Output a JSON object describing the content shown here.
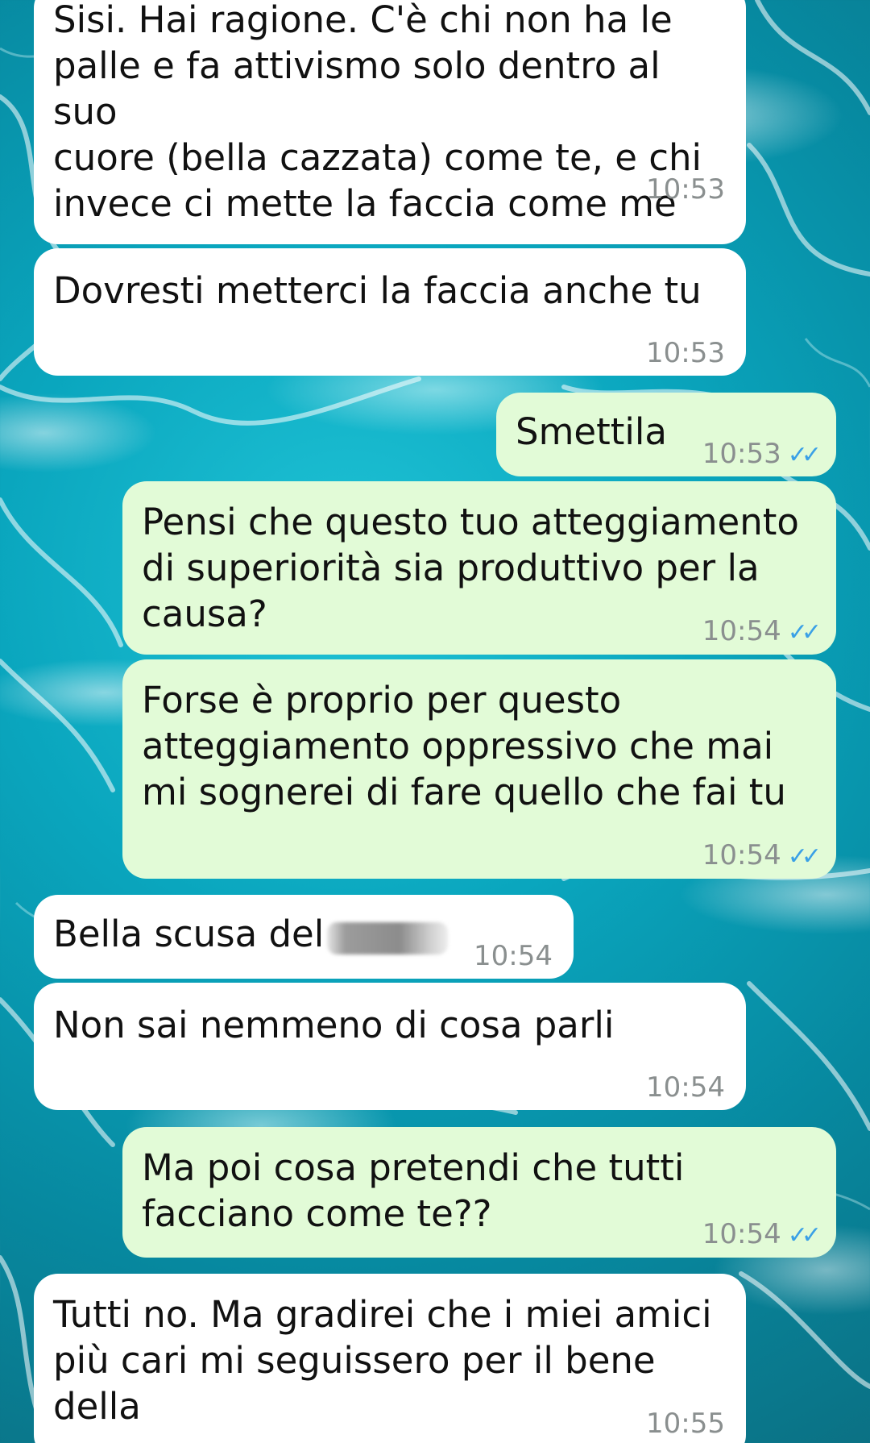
{
  "chat": {
    "messages": [
      {
        "direction": "incoming",
        "text": "Sisi. Hai ragione. C'è chi non ha le\npalle e fa attivismo solo dentro al suo\ncuore (bella cazzata) come te, e chi\ninvece ci mette la faccia come me",
        "time": "10:53"
      },
      {
        "direction": "incoming",
        "text": "Dovresti metterci la faccia anche tu",
        "time": "10:53"
      },
      {
        "direction": "outgoing",
        "text": "Smettila",
        "time": "10:53",
        "status": "read-double-check-icon"
      },
      {
        "direction": "outgoing",
        "text": "Pensi che questo tuo atteggiamento\ndi superiorità sia produttivo per la\ncausa?",
        "time": "10:54",
        "status": "read-double-check-icon"
      },
      {
        "direction": "outgoing",
        "text": "Forse è proprio per questo\natteggiamento oppressivo che mai\nmi sognerei di fare quello che fai tu",
        "time": "10:54",
        "status": "read-double-check-icon"
      },
      {
        "direction": "incoming",
        "text": "Bella scusa del",
        "time": "10:54",
        "redacted": true
      },
      {
        "direction": "incoming",
        "text": "Non sai nemmeno di cosa parli",
        "time": "10:54"
      },
      {
        "direction": "outgoing",
        "text": "Ma poi cosa pretendi che tutti\nfacciano come te??",
        "time": "10:54",
        "status": "read-double-check-icon"
      },
      {
        "direction": "incoming",
        "text": "Tutti no. Ma gradirei che i miei amici\npiù cari mi seguissero per il bene della\ncausa",
        "time": "10:55"
      }
    ]
  },
  "colors": {
    "incoming_bubble": "#ffffff",
    "outgoing_bubble": "#e2fbd7",
    "read_ticks": "#3aa0e6",
    "timestamp": "#8a8f8f",
    "background": "#0aa6be"
  }
}
